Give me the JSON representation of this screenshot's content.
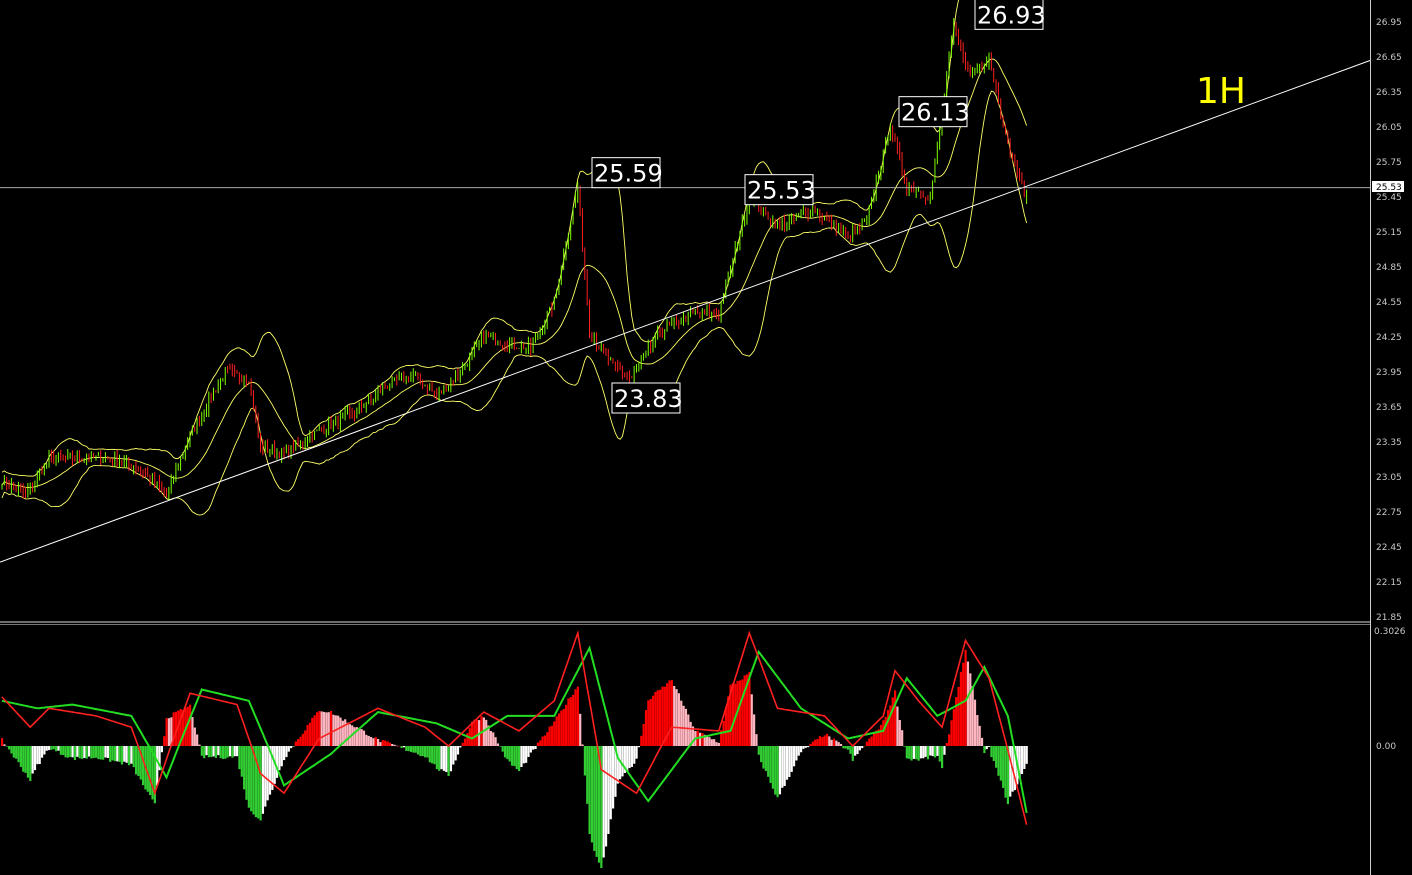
{
  "timeframe_label": "1H",
  "colors": {
    "background": "#000000",
    "bull_candle": "#7fff00",
    "bear_candle": "#ff2020",
    "bollinger_bands": "#ffff66",
    "trend_line": "#ffffff",
    "macd_hist_pos_strong": "#ff0000",
    "macd_hist_pos_weak": "#ffb6c1",
    "macd_hist_neg_strong": "#32cd32",
    "macd_hist_neg_weak": "#ffffff",
    "macd_line": "#ff2020",
    "signal_line": "#22dd22",
    "axis_text": "#c8c8c8"
  },
  "price_panel": {
    "y_ticks": [
      "26.95",
      "26.65",
      "26.35",
      "26.05",
      "25.75",
      "25.45",
      "25.15",
      "24.85",
      "24.55",
      "24.25",
      "23.95",
      "23.65",
      "23.35",
      "23.05",
      "22.75",
      "22.45",
      "22.15",
      "21.85"
    ],
    "last_price": "25.53",
    "callouts": [
      "25.59",
      "23.83",
      "25.53",
      "26.13",
      "26.93"
    ]
  },
  "indicator_panel": {
    "y_ticks": [
      "0.3026",
      "0.00"
    ]
  },
  "chart_data": [
    {
      "type": "line",
      "subtype": "candlestick",
      "overlays": [
        "bollinger_bands",
        "trend_line"
      ],
      "ylim": [
        21.85,
        26.95
      ],
      "key_levels": [
        {
          "label": "25.59",
          "value": 25.59
        },
        {
          "label": "23.83",
          "value": 23.83
        },
        {
          "label": "25.53",
          "value": 25.53
        },
        {
          "label": "26.13",
          "value": 26.13
        },
        {
          "label": "26.93",
          "value": 26.93
        }
      ],
      "horizontal_line": 25.53,
      "trend_line": {
        "start": 22.32,
        "end": 26.62
      },
      "close_path": [
        {
          "i": 0,
          "v": 23.02
        },
        {
          "i": 10,
          "v": 22.9
        },
        {
          "i": 20,
          "v": 23.2
        },
        {
          "i": 35,
          "v": 23.22
        },
        {
          "i": 50,
          "v": 23.2
        },
        {
          "i": 60,
          "v": 23.1
        },
        {
          "i": 70,
          "v": 22.9
        },
        {
          "i": 80,
          "v": 23.4
        },
        {
          "i": 95,
          "v": 23.95
        },
        {
          "i": 105,
          "v": 23.9
        },
        {
          "i": 110,
          "v": 23.3
        },
        {
          "i": 120,
          "v": 23.25
        },
        {
          "i": 135,
          "v": 23.45
        },
        {
          "i": 150,
          "v": 23.6
        },
        {
          "i": 165,
          "v": 23.85
        },
        {
          "i": 175,
          "v": 23.92
        },
        {
          "i": 185,
          "v": 23.75
        },
        {
          "i": 195,
          "v": 23.95
        },
        {
          "i": 205,
          "v": 24.25
        },
        {
          "i": 215,
          "v": 24.2
        },
        {
          "i": 225,
          "v": 24.15
        },
        {
          "i": 235,
          "v": 24.55
        },
        {
          "i": 245,
          "v": 25.55
        },
        {
          "i": 250,
          "v": 24.3
        },
        {
          "i": 260,
          "v": 24.0
        },
        {
          "i": 268,
          "v": 23.9
        },
        {
          "i": 280,
          "v": 24.3
        },
        {
          "i": 295,
          "v": 24.45
        },
        {
          "i": 305,
          "v": 24.45
        },
        {
          "i": 318,
          "v": 25.45
        },
        {
          "i": 330,
          "v": 25.2
        },
        {
          "i": 345,
          "v": 25.35
        },
        {
          "i": 360,
          "v": 25.1
        },
        {
          "i": 368,
          "v": 25.25
        },
        {
          "i": 378,
          "v": 26.05
        },
        {
          "i": 385,
          "v": 25.55
        },
        {
          "i": 395,
          "v": 25.45
        },
        {
          "i": 405,
          "v": 26.9
        },
        {
          "i": 412,
          "v": 26.5
        },
        {
          "i": 420,
          "v": 26.65
        },
        {
          "i": 428,
          "v": 25.9
        },
        {
          "i": 436,
          "v": 25.43
        }
      ],
      "bar_count": 437
    },
    {
      "type": "bar",
      "subtype": "macd_histogram",
      "series": [
        {
          "name": "MACD",
          "path": [
            {
              "i": 0,
              "v": 0.13
            },
            {
              "i": 12,
              "v": 0.05
            },
            {
              "i": 20,
              "v": 0.1
            },
            {
              "i": 40,
              "v": 0.08
            },
            {
              "i": 55,
              "v": 0.05
            },
            {
              "i": 65,
              "v": -0.12
            },
            {
              "i": 80,
              "v": 0.14
            },
            {
              "i": 100,
              "v": 0.11
            },
            {
              "i": 110,
              "v": -0.07
            },
            {
              "i": 120,
              "v": -0.12
            },
            {
              "i": 135,
              "v": 0.02
            },
            {
              "i": 160,
              "v": 0.1
            },
            {
              "i": 180,
              "v": 0.05
            },
            {
              "i": 190,
              "v": 0.0
            },
            {
              "i": 205,
              "v": 0.09
            },
            {
              "i": 220,
              "v": 0.04
            },
            {
              "i": 235,
              "v": 0.12
            },
            {
              "i": 245,
              "v": 0.3
            },
            {
              "i": 255,
              "v": -0.06
            },
            {
              "i": 270,
              "v": -0.12
            },
            {
              "i": 285,
              "v": 0.05
            },
            {
              "i": 305,
              "v": 0.04
            },
            {
              "i": 318,
              "v": 0.3
            },
            {
              "i": 330,
              "v": 0.1
            },
            {
              "i": 350,
              "v": 0.08
            },
            {
              "i": 362,
              "v": 0.0
            },
            {
              "i": 375,
              "v": 0.08
            },
            {
              "i": 380,
              "v": 0.2
            },
            {
              "i": 390,
              "v": 0.12
            },
            {
              "i": 400,
              "v": 0.05
            },
            {
              "i": 410,
              "v": 0.28
            },
            {
              "i": 420,
              "v": 0.18
            },
            {
              "i": 436,
              "v": -0.2
            }
          ]
        },
        {
          "name": "Signal",
          "path": [
            {
              "i": 0,
              "v": 0.12
            },
            {
              "i": 15,
              "v": 0.1
            },
            {
              "i": 30,
              "v": 0.11
            },
            {
              "i": 55,
              "v": 0.08
            },
            {
              "i": 70,
              "v": -0.08
            },
            {
              "i": 85,
              "v": 0.15
            },
            {
              "i": 105,
              "v": 0.12
            },
            {
              "i": 120,
              "v": -0.1
            },
            {
              "i": 140,
              "v": -0.02
            },
            {
              "i": 160,
              "v": 0.09
            },
            {
              "i": 185,
              "v": 0.06
            },
            {
              "i": 200,
              "v": 0.02
            },
            {
              "i": 215,
              "v": 0.08
            },
            {
              "i": 235,
              "v": 0.08
            },
            {
              "i": 250,
              "v": 0.26
            },
            {
              "i": 262,
              "v": -0.03
            },
            {
              "i": 275,
              "v": -0.14
            },
            {
              "i": 295,
              "v": 0.02
            },
            {
              "i": 310,
              "v": 0.04
            },
            {
              "i": 322,
              "v": 0.25
            },
            {
              "i": 340,
              "v": 0.1
            },
            {
              "i": 360,
              "v": 0.02
            },
            {
              "i": 375,
              "v": 0.04
            },
            {
              "i": 385,
              "v": 0.18
            },
            {
              "i": 398,
              "v": 0.08
            },
            {
              "i": 410,
              "v": 0.12
            },
            {
              "i": 418,
              "v": 0.21
            },
            {
              "i": 428,
              "v": 0.08
            },
            {
              "i": 436,
              "v": -0.17
            }
          ]
        }
      ],
      "ylim": [
        -0.31,
        0.3026
      ]
    }
  ]
}
